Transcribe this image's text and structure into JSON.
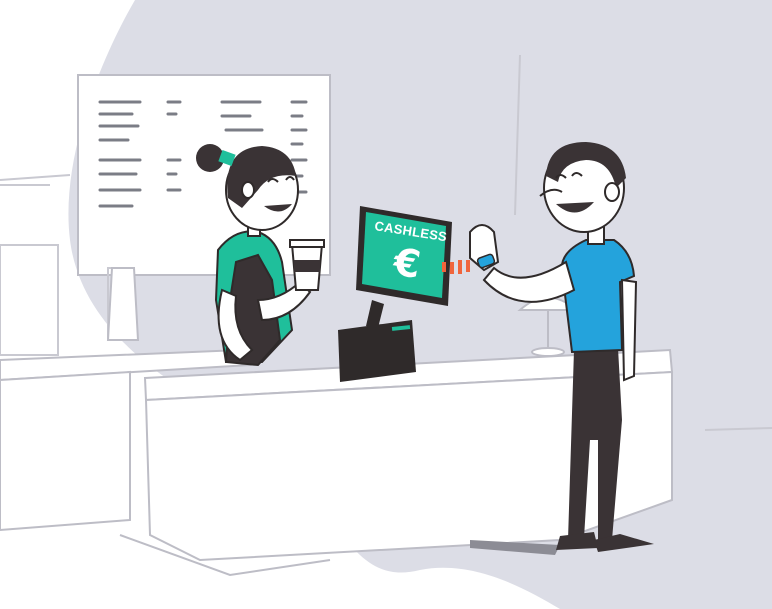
{
  "scene": {
    "description_free": true,
    "pos_screen": {
      "label": "CASHLESS",
      "currency_symbol": "€"
    },
    "colors": {
      "background_blob": "#dcdde6",
      "accent_green": "#1fbf9b",
      "shirt_blue": "#24a3dc",
      "nfc_waves": "#f0643c",
      "outline": "#2f2a2a"
    },
    "icons": [
      "pos-terminal-icon",
      "coffee-cup-icon",
      "euro-icon",
      "contactless-wristband-icon"
    ]
  }
}
